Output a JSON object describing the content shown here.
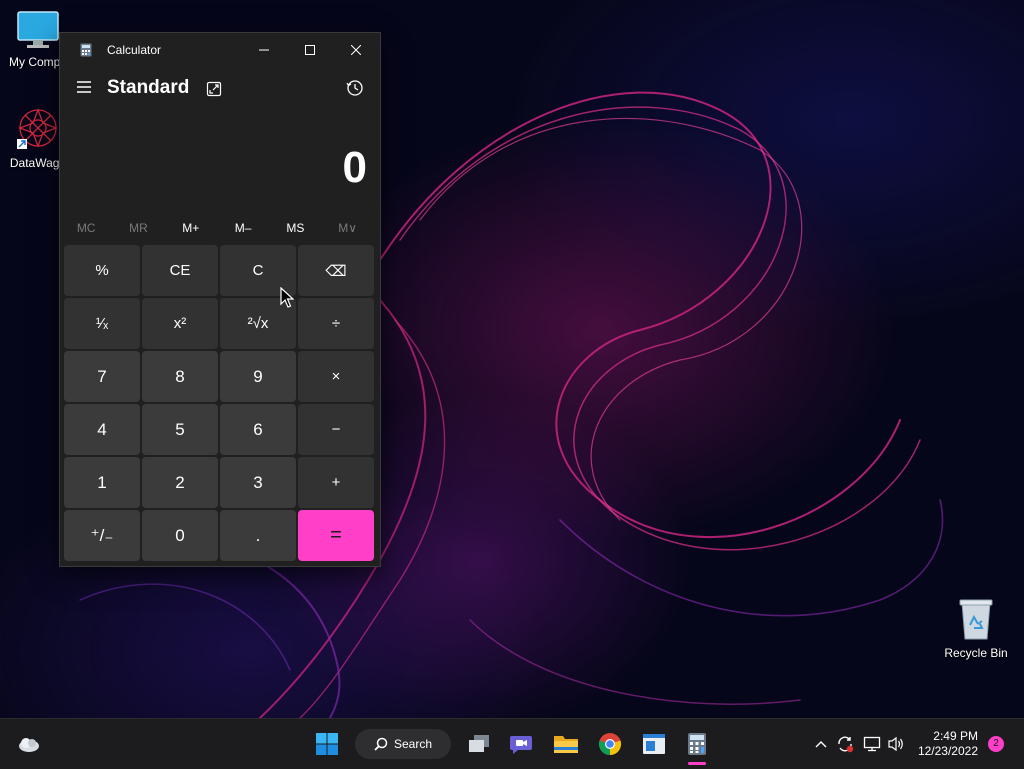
{
  "desktop": {
    "icons": [
      {
        "label": "My Compu",
        "icon": "monitor-icon"
      },
      {
        "label": "DataWago",
        "icon": "datawagon-icon"
      }
    ],
    "recycle_bin": {
      "label": "Recycle Bin",
      "icon": "recycle-bin-icon"
    }
  },
  "calculator": {
    "window_title": "Calculator",
    "mode": "Standard",
    "display": "0",
    "memory": [
      "MC",
      "MR",
      "M+",
      "M–",
      "MS",
      "M∨"
    ],
    "keys": [
      {
        "label": "%",
        "kind": "op"
      },
      {
        "label": "CE",
        "kind": "op"
      },
      {
        "label": "C",
        "kind": "op"
      },
      {
        "label": "⌫",
        "kind": "op"
      },
      {
        "label": "¹⁄ₓ",
        "kind": "op"
      },
      {
        "label": "x²",
        "kind": "op"
      },
      {
        "label": "²√x",
        "kind": "op"
      },
      {
        "label": "÷",
        "kind": "op"
      },
      {
        "label": "7",
        "kind": "num"
      },
      {
        "label": "8",
        "kind": "num"
      },
      {
        "label": "9",
        "kind": "num"
      },
      {
        "label": "×",
        "kind": "op"
      },
      {
        "label": "4",
        "kind": "num"
      },
      {
        "label": "5",
        "kind": "num"
      },
      {
        "label": "6",
        "kind": "num"
      },
      {
        "label": "−",
        "kind": "op"
      },
      {
        "label": "1",
        "kind": "num"
      },
      {
        "label": "2",
        "kind": "num"
      },
      {
        "label": "3",
        "kind": "num"
      },
      {
        "label": "+",
        "kind": "op"
      },
      {
        "label": "⁺/₋",
        "kind": "num"
      },
      {
        "label": "0",
        "kind": "num"
      },
      {
        "label": ".",
        "kind": "num"
      },
      {
        "label": "=",
        "kind": "equals"
      }
    ],
    "accent": "#ff3fc7"
  },
  "taskbar": {
    "search_label": "Search",
    "time": "2:49 PM",
    "date": "12/23/2022",
    "notifications": "2"
  }
}
